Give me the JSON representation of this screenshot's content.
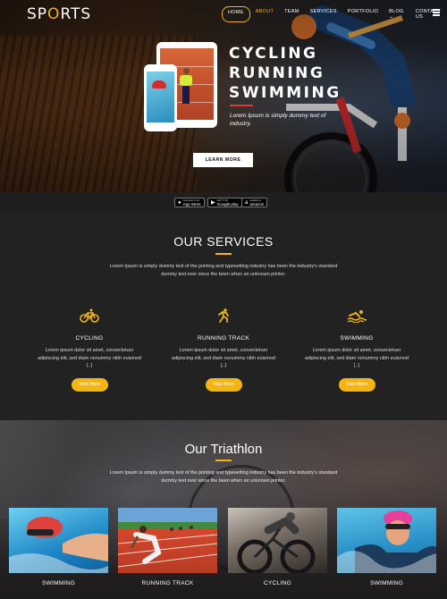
{
  "brand": {
    "prefix": "SP",
    "medal": "O",
    "suffix": "RTS"
  },
  "nav": {
    "items": [
      {
        "label": "HOME",
        "state": "active"
      },
      {
        "label": "ABOUT",
        "state": "highlight"
      },
      {
        "label": "TEAM",
        "state": "normal"
      },
      {
        "label": "SERVICES",
        "state": "normal"
      },
      {
        "label": "PORTFOLIO",
        "state": "normal"
      },
      {
        "label": "BLOG ⌄",
        "state": "normal"
      },
      {
        "label": "CONTACT US",
        "state": "normal"
      }
    ],
    "menu_icon": "hamburger-icon"
  },
  "hero": {
    "lines": [
      "CYCLING",
      "RUNNING",
      "SWIMMING"
    ],
    "text": "Lorem Ipsum is simply dummy text of industry.",
    "button": "LEARN MORE"
  },
  "stores": [
    {
      "small": "Download on the",
      "big": "App Store",
      "icon": "apple-icon"
    },
    {
      "small": "GET IT ON",
      "big": "Google play",
      "icon": "play-icon"
    },
    {
      "small": "available at",
      "big": "amazon",
      "icon": "amazon-icon"
    }
  ],
  "services": {
    "title": "OUR SERVICES",
    "desc": "Lorem Ipsum is simply dummy text of the printing and typesetting industry has been the industry's standard dummy text ever since the been when an unknown printer.",
    "items": [
      {
        "name": "CYCLING",
        "icon": "bicycle-icon",
        "text": "Lorem ipsum dolor sit amet, consectetuer adipiscing elit, sed diam nonummy nibh euismod [..]",
        "button": "View More"
      },
      {
        "name": "RUNNING TRACK",
        "icon": "runner-icon",
        "text": "Lorem ipsum dolor sit amet, consectetuer adipiscing elit, sed diam nonummy nibh euismod [..]",
        "button": "View More"
      },
      {
        "name": "SWIMMING",
        "icon": "swimmer-icon",
        "text": "Lorem ipsum dolor sit amet, consectetuer adipiscing elit, sed diam nonummy nibh euismod [..]",
        "button": "View More"
      }
    ]
  },
  "triathlon": {
    "title": "Our Triathlon",
    "desc": "Lorem Ipsum is simply dummy text of the printing and typesetting industry has been the industry's standard dummy text ever since the been when an unknown printer.",
    "cards": [
      {
        "label": "SWIMMING"
      },
      {
        "label": "RUNNING TRACK"
      },
      {
        "label": "CYCLING"
      },
      {
        "label": "SWIMMING"
      }
    ]
  },
  "colors": {
    "accent": "#f2b514",
    "hero_line": "#e23a3a",
    "background": "#222222"
  }
}
